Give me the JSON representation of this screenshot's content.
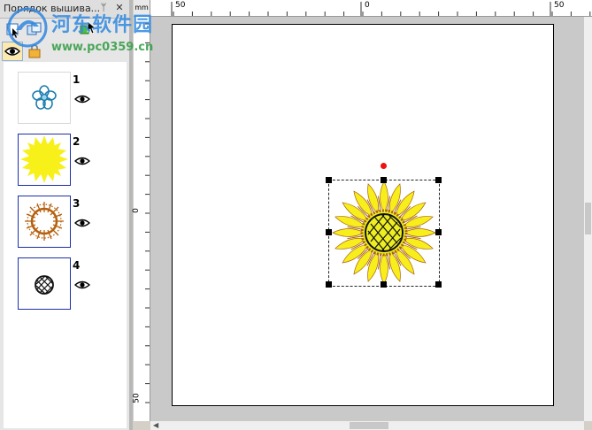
{
  "panel": {
    "title": "Порядок вышива...",
    "pin_glyph": "ᛘ",
    "close_glyph": "✕",
    "items": [
      {
        "number": "1",
        "icon": "blue-flower-thumbnail",
        "visibility_icon": "eye-icon",
        "selected": false
      },
      {
        "number": "2",
        "icon": "yellow-petals-thumbnail",
        "visibility_icon": "eye-icon",
        "selected": true
      },
      {
        "number": "3",
        "icon": "orange-ring-thumbnail",
        "visibility_icon": "eye-icon",
        "selected": true
      },
      {
        "number": "4",
        "icon": "black-mesh-circle-thumbnail",
        "visibility_icon": "eye-icon",
        "selected": true
      }
    ]
  },
  "ruler": {
    "unit": "mm",
    "h_labels": [
      "50",
      "0",
      "50"
    ],
    "v_labels": [
      "0",
      "50"
    ]
  },
  "canvas": {
    "selected_object": "sunflower-design",
    "colors": {
      "petal": "#f7ee1b",
      "stitch": "#a8620f",
      "center": "#eded21",
      "outline": "#111111",
      "rotate_handle": "#ee1111"
    }
  },
  "watermark": {
    "title": "河东软件园",
    "url": "www.pc0359.cn"
  }
}
